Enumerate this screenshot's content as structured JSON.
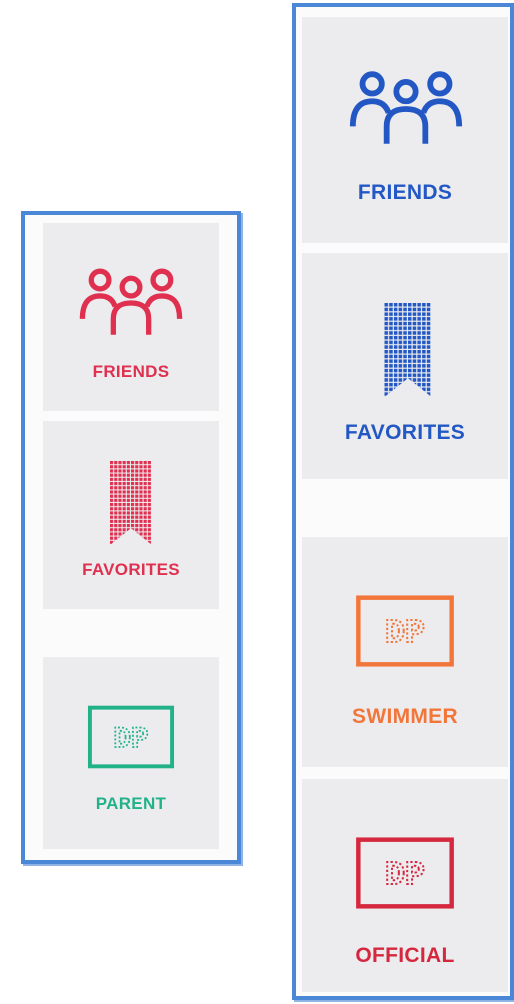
{
  "colors": {
    "frame": "#4a87d6",
    "card": "#ececef",
    "red": "#e0304f",
    "blue": "#2358c4",
    "green": "#22b288",
    "orange": "#f2763a",
    "crimson": "#d5283e"
  },
  "left_panel": {
    "items": [
      {
        "label": "FRIENDS",
        "icon": "friends-icon"
      },
      {
        "label": "FAVORITES",
        "icon": "bookmark-icon"
      },
      {
        "label": "PARENT",
        "icon": "dp-badge-icon",
        "badge_text": "DP"
      }
    ]
  },
  "right_panel": {
    "items": [
      {
        "label": "FRIENDS",
        "icon": "friends-icon"
      },
      {
        "label": "FAVORITES",
        "icon": "bookmark-icon"
      },
      {
        "label": "SWIMMER",
        "icon": "dp-badge-icon",
        "badge_text": "DP"
      },
      {
        "label": "OFFICIAL",
        "icon": "dp-badge-icon",
        "badge_text": "DP"
      }
    ]
  }
}
